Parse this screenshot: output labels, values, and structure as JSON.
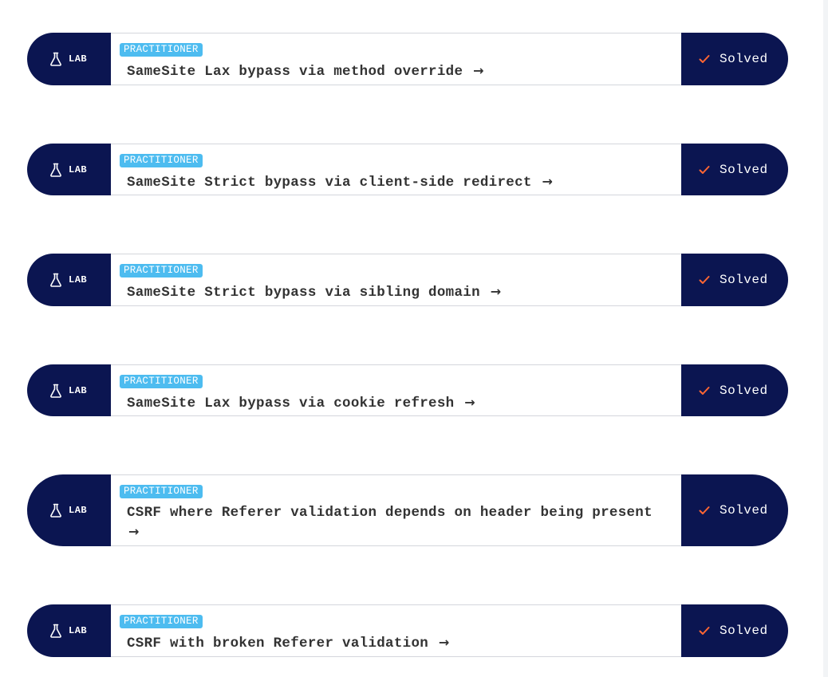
{
  "labs": [
    {
      "type_label": "LAB",
      "level": "PRACTITIONER",
      "title": "SameSite Lax bypass via method override",
      "status": "Solved"
    },
    {
      "type_label": "LAB",
      "level": "PRACTITIONER",
      "title": "SameSite Strict bypass via client-side redirect",
      "status": "Solved"
    },
    {
      "type_label": "LAB",
      "level": "PRACTITIONER",
      "title": "SameSite Strict bypass via sibling domain",
      "status": "Solved"
    },
    {
      "type_label": "LAB",
      "level": "PRACTITIONER",
      "title": "SameSite Lax bypass via cookie refresh",
      "status": "Solved"
    },
    {
      "type_label": "LAB",
      "level": "PRACTITIONER",
      "title": "CSRF where Referer validation depends on header being present",
      "status": "Solved"
    },
    {
      "type_label": "LAB",
      "level": "PRACTITIONER",
      "title": "CSRF with broken Referer validation",
      "status": "Solved"
    }
  ],
  "icons": {
    "lab": "flask-icon",
    "link": "arrow-right-icon",
    "status": "check-icon"
  },
  "colors": {
    "navy": "#0b1551",
    "badge_blue": "#4dbcf0",
    "check_orange": "#ff6633",
    "title_text": "#333333"
  }
}
